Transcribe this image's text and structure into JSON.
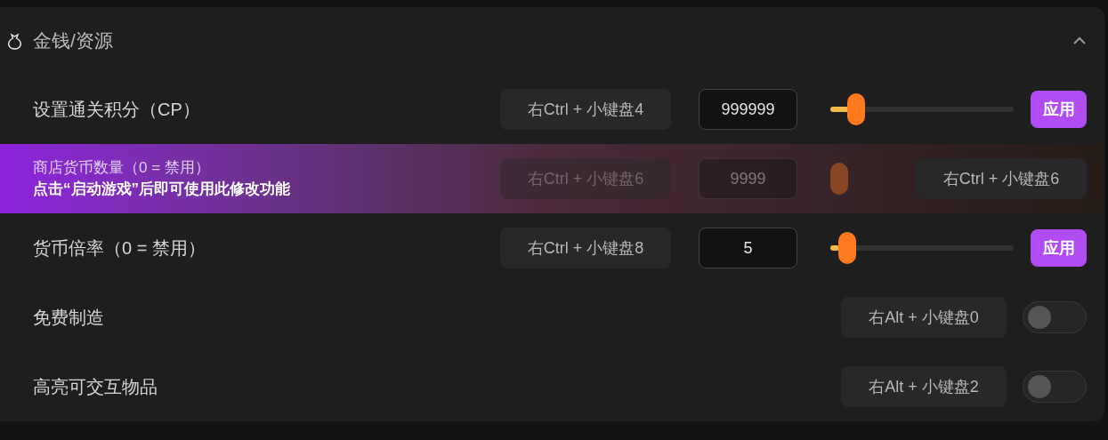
{
  "section": {
    "title": "金钱/资源",
    "expanded": true
  },
  "rows": [
    {
      "kind": "slider",
      "label": "设置通关积分（CP）",
      "shortcut": "右Ctrl + 小键盘4",
      "value": "999999",
      "level": 0.1,
      "button": "应用"
    },
    {
      "kind": "locked",
      "label": "商店货币数量（0 = 禁用）",
      "hint": "点击“启动游戏”后即可使用此修改功能",
      "shortcut": "右Ctrl + 小键盘6",
      "value": "9999",
      "overlay_shortcut": "右Ctrl + 小键盘6"
    },
    {
      "kind": "slider",
      "label": "货币倍率（0 = 禁用）",
      "shortcut": "右Ctrl + 小键盘8",
      "value": "5",
      "level": 0.05,
      "button": "应用"
    },
    {
      "kind": "toggle",
      "label": "免费制造",
      "shortcut": "右Alt + 小键盘0",
      "on": false
    },
    {
      "kind": "toggle",
      "label": "高亮可交互物品",
      "shortcut": "右Alt + 小键盘2",
      "on": false
    }
  ]
}
